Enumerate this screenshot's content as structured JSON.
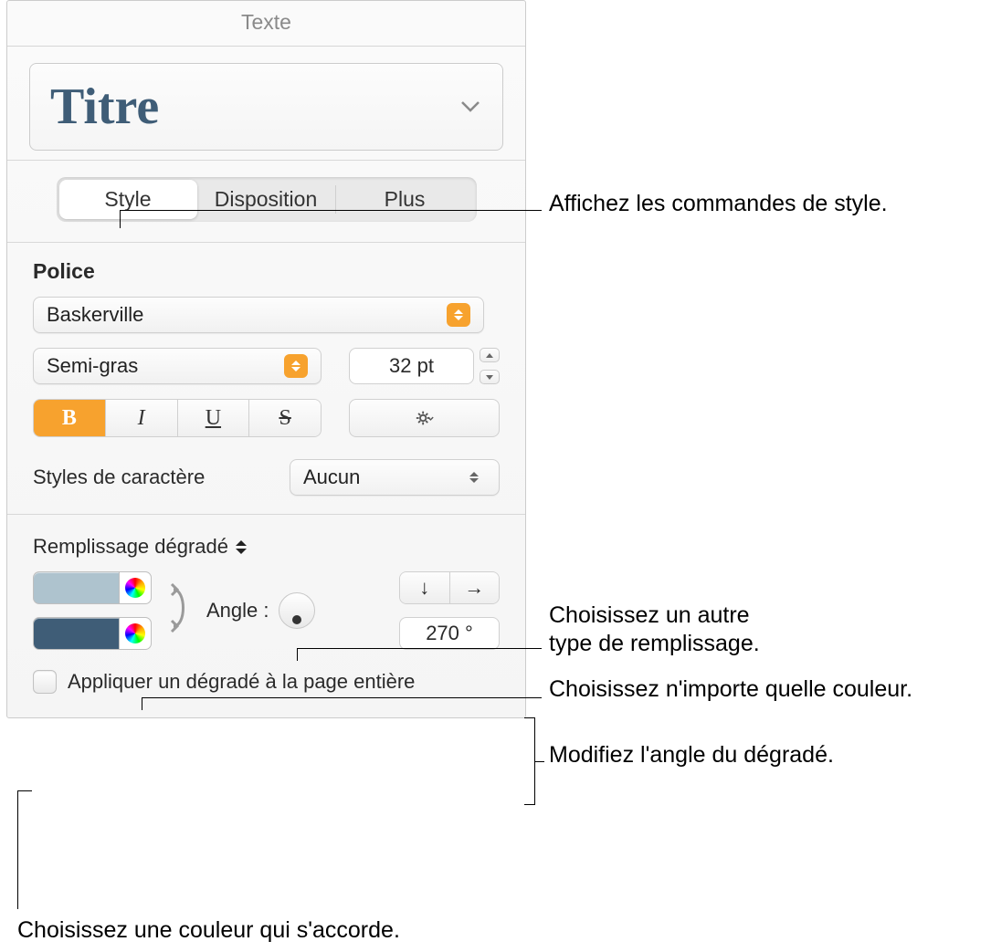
{
  "pane": {
    "title": "Texte"
  },
  "styleDropdown": {
    "label": "Titre"
  },
  "tabs": {
    "style": "Style",
    "disposition": "Disposition",
    "plus": "Plus"
  },
  "police": {
    "heading": "Police",
    "family": "Baskerville",
    "weight": "Semi-gras",
    "size": "32 pt",
    "bold": "B",
    "italic": "I",
    "underline": "U",
    "strike": "S"
  },
  "charStyle": {
    "label": "Styles de caractère",
    "value": "Aucun"
  },
  "fill": {
    "heading": "Remplissage dégradé",
    "angleLabel": "Angle :",
    "angleValue": "270 °",
    "arrowDown": "↓",
    "arrowRight": "→",
    "applyLabel": "Appliquer un dégradé à la page entière",
    "colors": {
      "top": "#aec3ce",
      "bottom": "#3f5d77"
    }
  },
  "callouts": {
    "styleControls": "Affichez les commandes de style.",
    "fillType1": "Choisissez un autre",
    "fillType2": "type de remplissage.",
    "anyColor": "Choisissez n'importe quelle couleur.",
    "changeAngle": "Modifiez l'angle du dégradé.",
    "matchColor": "Choisissez une couleur qui s'accorde."
  }
}
